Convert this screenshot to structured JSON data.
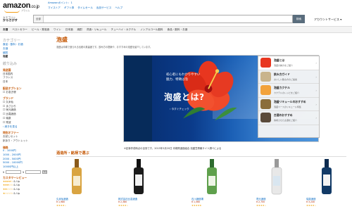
{
  "header": {
    "logo_text": "amazon",
    "logo_suffix": ".co.jp",
    "logo_sub": "プライム",
    "points_link": "Amazonポイント：1",
    "nav": [
      "マイストア",
      "ギフト券",
      "タイムセール",
      "出品サービス",
      "ヘルプ"
    ],
    "category_label_top": "カテゴリー",
    "category_label_main": "からさがす",
    "search_scope": "全部",
    "search_placeholder": "",
    "search_button": "検索",
    "account_label": "アカウントサービス ▾"
  },
  "category_nav": [
    "お酒",
    "ベストセラー",
    "ビール・発泡酒",
    "ワイン",
    "日本酒",
    "焼酎",
    "洋酒・リキュール",
    "チューハイ・カクテル",
    "ノンアルコール飲料",
    "食品・飲料・お酒"
  ],
  "sidebar": {
    "head1": "カテゴリー",
    "cats": [
      "食品・飲料・お酒",
      "お酒",
      "焼酎",
      "泡盛"
    ],
    "head2": "絞り込み",
    "region_title": "発送国",
    "regions": [
      "日本国内",
      "フランス",
      "日本"
    ],
    "delivery_title": "配送オプション",
    "delivery": "お急ぎ便",
    "brand_title": "ブランド",
    "brands": [
      "久米仙",
      "まさひろ",
      "咲元酒造",
      "比嘉酒造",
      "瑞泉",
      "残波"
    ],
    "more_link": "› 続きを見る",
    "offers_title": "特別オファー",
    "offers": [
      "お試しセット",
      "訳あり・アウトレット"
    ],
    "price_title": "価格",
    "prices": [
      "0 - 1000円",
      "1000 - 2000円",
      "2000 - 5000円",
      "5000 - 10000円",
      "10000円以上"
    ],
    "price_currency": "¥",
    "go_label": "Go",
    "review_title": "カスタマーレビュー",
    "review_rows": [
      "& Up",
      "& Up",
      "& Up",
      "& Up"
    ]
  },
  "main": {
    "title": "泡盛",
    "description": "泡盛は沖縄で造られる伝統の蒸留酒です。飲み方の提案や、おすすめの泡盛を紹介しています。",
    "banner": {
      "line1": "初心者にもわかりやすい",
      "line2": "魅力、特徴は泡",
      "big": "泡盛とは?",
      "link": "› 今すぐチェック"
    },
    "menu": [
      {
        "title": "泡盛とは",
        "sub": "泡盛の魅力をご紹介"
      },
      {
        "title": "飲み方ガイド",
        "sub": "おいしい飲み方のご提案"
      },
      {
        "title": "泡盛カクテル",
        "sub": "カクテルのレシピをご紹介"
      },
      {
        "title": "泡盛リキュールのおすすめ",
        "sub": "泡盛ベースのリキュール特集"
      },
      {
        "title": "古酒のおすすめ",
        "sub": "熟成させた古酒をご紹介"
      }
    ],
    "caption": "※記事作成時点の目安です。2015年3月20日 沖縄県酒造組合 泡盛豆情報サイト調べによる",
    "section_title": "酒造所・銘柄で選ぶ",
    "products": [
      {
        "name": "久米仙酒造",
        "price": "¥ 1,980",
        "stars": "★★★★☆"
      },
      {
        "name": "株式会社比嘉酒造",
        "price": "¥ 2,380",
        "stars": "★★★★☆"
      },
      {
        "name": "石川酒造場",
        "price": "¥ 1,560",
        "stars": "★★★★★"
      },
      {
        "name": "咲元酒造",
        "price": "¥ 2,700",
        "stars": "★★★★☆"
      },
      {
        "name": "瑞泉酒造",
        "price": "¥ 3,240",
        "stars": "★★★★☆"
      }
    ]
  },
  "colors": {
    "accent": "#c45500",
    "link": "#0066c0",
    "banner_blue": "#0b3b8a",
    "hibiscus": "#e8361f"
  }
}
